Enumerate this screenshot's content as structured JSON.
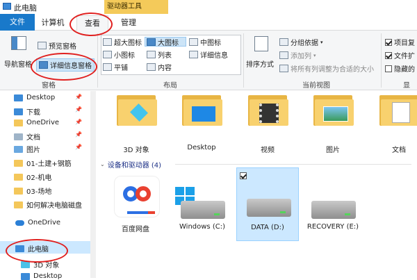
{
  "window": {
    "title": "此电脑",
    "context_tab": "驱动器工具"
  },
  "tabs": {
    "file": "文件",
    "computer": "计算机",
    "view": "查看",
    "manage": "管理"
  },
  "ribbon": {
    "pane": {
      "nav_pane": "导航窗格",
      "preview_pane": "预览窗格",
      "details_pane": "详细信息窗格",
      "label": "窗格"
    },
    "layout": {
      "xl_icons": "超大图标",
      "large_icons": "大图标",
      "medium_icons": "中图标",
      "small_icons": "小图标",
      "list": "列表",
      "details": "详细信息",
      "tiles": "平铺",
      "content": "内容",
      "label": "布局"
    },
    "current_view": {
      "sort_by": "排序方式",
      "group_by": "分组依据",
      "add_columns": "添加列",
      "fit_columns": "将所有列调整为合适的大小",
      "label": "当前视图"
    },
    "show_hide": {
      "item_checkboxes": "项目复",
      "file_ext": "文件扩",
      "hidden_items": "隐藏的",
      "label": "显"
    }
  },
  "nav": {
    "items": [
      {
        "label": "Desktop",
        "pinned": true
      },
      {
        "label": "下载",
        "pinned": true
      },
      {
        "label": "OneDrive",
        "pinned": true
      },
      {
        "label": "文档",
        "pinned": true
      },
      {
        "label": "图片",
        "pinned": true
      },
      {
        "label": "01-土建+钢筋",
        "pinned": false
      },
      {
        "label": "02-机电",
        "pinned": false
      },
      {
        "label": "03-场地",
        "pinned": false
      },
      {
        "label": "如何解决电脑磁盘",
        "pinned": false
      },
      {
        "label": "OneDrive",
        "pinned": false
      },
      {
        "label": "此电脑",
        "pinned": false
      },
      {
        "label": "3D 对象",
        "pinned": false
      },
      {
        "label": "Desktop",
        "pinned": false
      }
    ]
  },
  "folders": [
    "3D 对象",
    "Desktop",
    "视频",
    "图片",
    "文档"
  ],
  "devices": {
    "header": "设备和驱动器 (4)",
    "items": [
      "百度网盘",
      "Windows (C:)",
      "DATA (D:)",
      "RECOVERY (E:)"
    ]
  },
  "colors": {
    "accent": "#1979ca",
    "context_tab": "#f4ca5a",
    "annotation": "#e0201f",
    "selection": "#cce8ff"
  }
}
